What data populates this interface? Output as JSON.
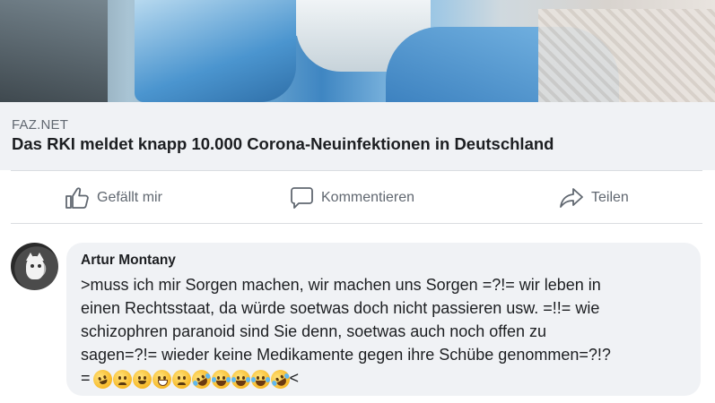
{
  "post": {
    "link_domain": "FAZ.NET",
    "link_title": "Das RKI meldet knapp 10.000 Corona-Neuinfektionen in Deutschland",
    "image_icon": "hospital-photo"
  },
  "actions": {
    "like_label": "Gefällt mir",
    "comment_label": "Kommentieren",
    "share_label": "Teilen"
  },
  "comment": {
    "author": "Artur Montany",
    "lines": [
      ">muss ich mir Sorgen machen, wir machen uns Sorgen =?!=  wir leben in",
      "einen Rechtsstaat, da würde soetwas doch nicht passieren usw. =!!= wie",
      "schizophren paranoid sind Sie denn, soetwas auch noch offen zu",
      "sagen=?!= wieder keine Medikamente gegen ihre Schübe genommen=?!?",
      "="
    ],
    "trailing_text": "<",
    "emojis": [
      "dizzy-face-emoji",
      "worried-face-emoji",
      "yawning-face-emoji",
      "grimacing-face-emoji",
      "tired-face-emoji",
      "rofl-emoji",
      "joy-emoji",
      "joy-emoji",
      "joy-emoji",
      "rofl-emoji"
    ]
  },
  "colors": {
    "link_background": "#f0f2f5",
    "bubble_background": "#f0f2f5",
    "secondary_text": "#606770",
    "primary_text": "#1c1e21"
  }
}
